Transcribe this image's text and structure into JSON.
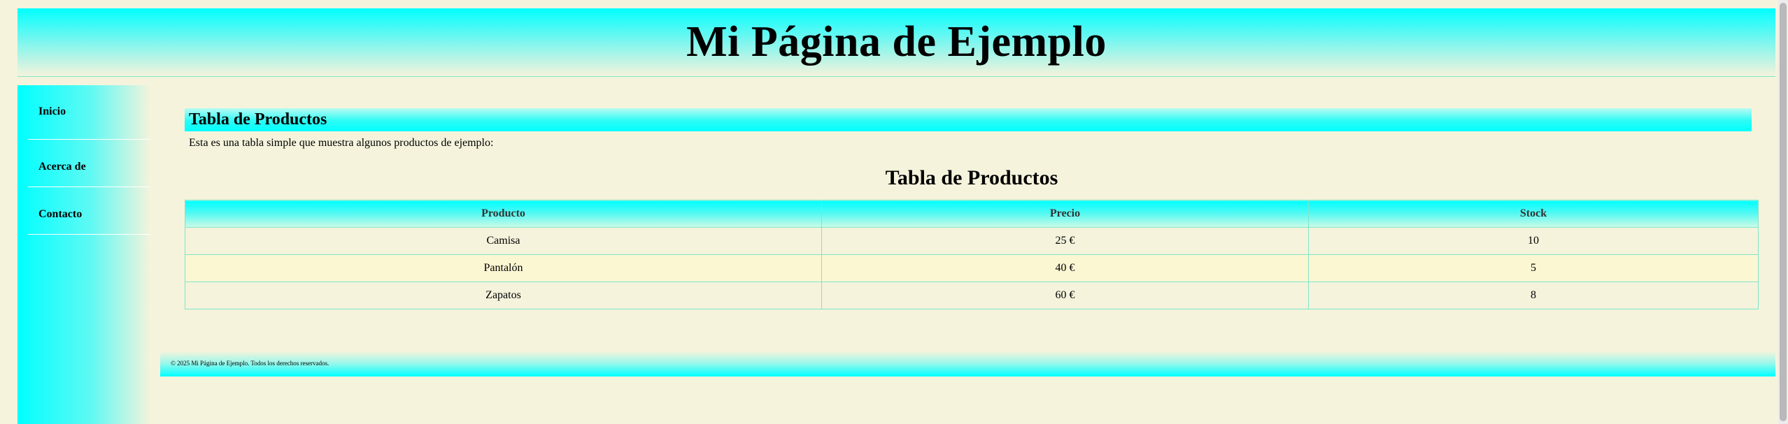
{
  "header": {
    "title": "Mi Página de Ejemplo"
  },
  "sidebar": {
    "items": [
      {
        "label": "Inicio"
      },
      {
        "label": "Acerca de"
      },
      {
        "label": "Contacto"
      }
    ]
  },
  "main": {
    "section_title": "Tabla de Productos",
    "description": "Esta es una tabla simple que muestra algunos productos de ejemplo:",
    "table": {
      "caption": "Tabla de Productos",
      "headers": [
        "Producto",
        "Precio",
        "Stock"
      ],
      "rows": [
        [
          "Camisa",
          "25 €",
          "10"
        ],
        [
          "Pantalón",
          "40 €",
          "5"
        ],
        [
          "Zapatos",
          "60 €",
          "8"
        ]
      ]
    }
  },
  "footer": {
    "text": "© 2025 Mi Página de Ejemplo. Todos los derechos reservados."
  },
  "colors": {
    "background": "#f5f3dc",
    "accent": "#00ffff",
    "border": "#7fe6c8",
    "row_alt": "#fcf7d3"
  }
}
